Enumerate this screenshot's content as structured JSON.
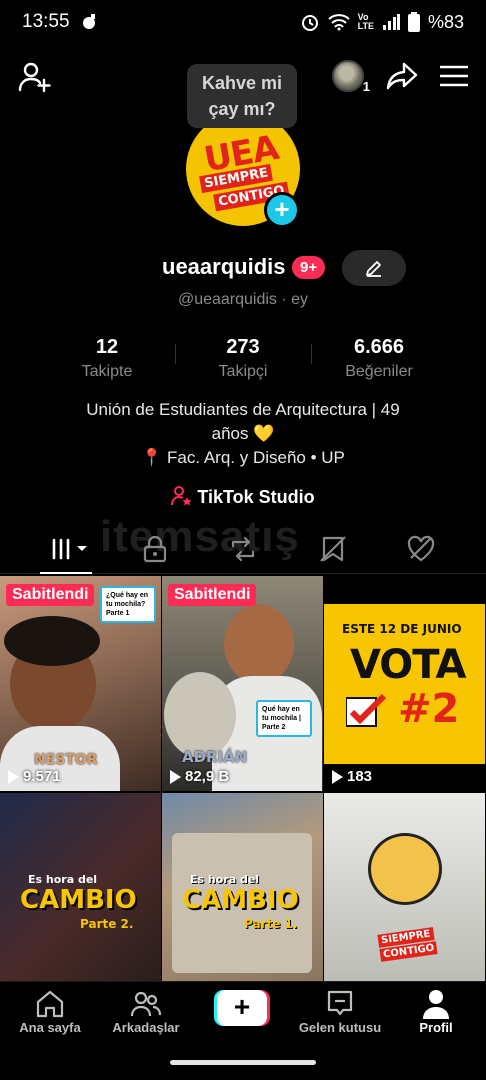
{
  "status_bar": {
    "time": "13:55",
    "battery": "%83",
    "icons": [
      "notification-icon",
      "alarm-icon",
      "wifi-icon",
      "volte-icon",
      "signal-icon",
      "battery-icon"
    ]
  },
  "tooltip": {
    "line1": "Kahve mi",
    "line2": "çay mı?"
  },
  "profile": {
    "avatar_text": {
      "line1": "UEA",
      "line2": "SIEMPRE",
      "line3": "CONTIGO"
    },
    "username": "ueaarquidis",
    "notification_count": "9+",
    "handle": "@ueaarquidis · ey",
    "following_switch_badge": "1"
  },
  "stats": [
    {
      "value": "12",
      "label": "Takipte"
    },
    {
      "value": "273",
      "label": "Takipçi"
    },
    {
      "value": "6.666",
      "label": "Beğeniler"
    }
  ],
  "bio": {
    "line1": "Unión de Estudiantes de Arquitectura | 49",
    "line2": "años 💛",
    "line3": "📍 Fac. Arq. y Diseño • UP"
  },
  "studio_label": "TikTok Studio",
  "watermark": "itemsatış",
  "videos": [
    {
      "pinned": "Sabitlendi",
      "views": "9.571",
      "sticker": "¿Qué hay en tu mochila? Parte 1",
      "caption": "NESTOR"
    },
    {
      "pinned": "Sabitlendi",
      "views": "82,9 B",
      "sticker": "Qué hay en tu mochila | Parte 2",
      "caption": "ADRIÁN"
    },
    {
      "views": "183",
      "title1": "ESTE 12 DE JUNIO",
      "title2": "VOTA",
      "title3": "#2"
    },
    {
      "caption1": "Es hora del",
      "caption2": "CAMBIO",
      "caption3": "Parte 2."
    },
    {
      "caption1": "Es hora del",
      "caption2": "CAMBIO",
      "caption3": "Parte 1."
    },
    {
      "caption1": "SIEMPRE",
      "caption2": "CONTIGO"
    }
  ],
  "bottom_nav": [
    {
      "label": "Ana sayfa",
      "icon": "home-icon"
    },
    {
      "label": "Arkadaşlar",
      "icon": "friends-icon"
    },
    {
      "label": "",
      "icon": "create-icon"
    },
    {
      "label": "Gelen kutusu",
      "icon": "inbox-icon"
    },
    {
      "label": "Profil",
      "icon": "profile-icon"
    }
  ],
  "colors": {
    "accent_pink": "#fe2c55",
    "accent_cyan": "#25f4ee",
    "avatar_yellow": "#f5c400"
  }
}
